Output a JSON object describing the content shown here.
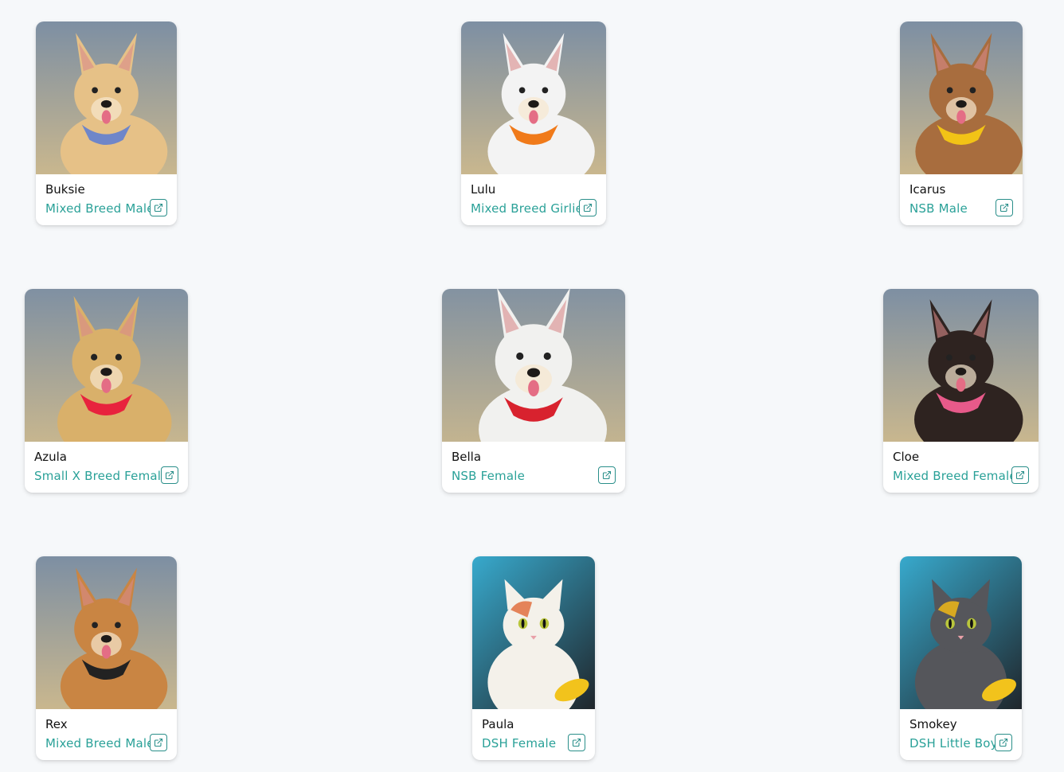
{
  "pets": [
    {
      "name": "Buksie",
      "description": "Mixed Breed Male",
      "animal": "dog",
      "colors": {
        "bg1": "#7d8fa3",
        "bg2": "#c9b78e",
        "fur": "#e6c187",
        "accent": "#6f86c9"
      }
    },
    {
      "name": "Lulu",
      "description": "Mixed Breed Girlie",
      "animal": "dog",
      "colors": {
        "bg1": "#8fae5b",
        "bg2": "#e7c12b",
        "fur": "#f3f3f3",
        "accent": "#f07a1a"
      }
    },
    {
      "name": "Icarus",
      "description": "NSB Male",
      "animal": "dog",
      "colors": {
        "bg1": "#a7a05b",
        "bg2": "#8c8a4a",
        "fur": "#a86d3e",
        "accent": "#f2c316"
      }
    },
    {
      "name": "Azula",
      "description": "Small X Breed Female",
      "animal": "dog",
      "colors": {
        "bg1": "#7a4f63",
        "bg2": "#b07a8a",
        "fur": "#d9b06a",
        "accent": "#e8223d"
      }
    },
    {
      "name": "Bella",
      "description": "NSB Female",
      "animal": "dog",
      "colors": {
        "bg1": "#7b756a",
        "bg2": "#4b4640",
        "fur": "#f1f1ef",
        "accent": "#d8222e"
      }
    },
    {
      "name": "Cloe",
      "description": "Mixed Breed Female",
      "animal": "dog",
      "colors": {
        "bg1": "#9cc7c4",
        "bg2": "#37b6e0",
        "fur": "#2e2320",
        "accent": "#e75a8a"
      }
    },
    {
      "name": "Rex",
      "description": "Mixed Breed Male",
      "animal": "dog",
      "colors": {
        "bg1": "#7a6a55",
        "bg2": "#9a8a70",
        "fur": "#c98543",
        "accent": "#222222"
      }
    },
    {
      "name": "Paula",
      "description": "DSH Female",
      "animal": "cat",
      "colors": {
        "bg1": "#39b1d6",
        "bg2": "#1e1e22",
        "fur": "#f4f1ea",
        "accent": "#e07040"
      }
    },
    {
      "name": "Smokey",
      "description": "DSH Little Boy",
      "animal": "cat",
      "colors": {
        "bg1": "#c9c9cc",
        "bg2": "#9aa0a6",
        "fur": "#55565b",
        "accent": "#f0b718"
      }
    }
  ]
}
